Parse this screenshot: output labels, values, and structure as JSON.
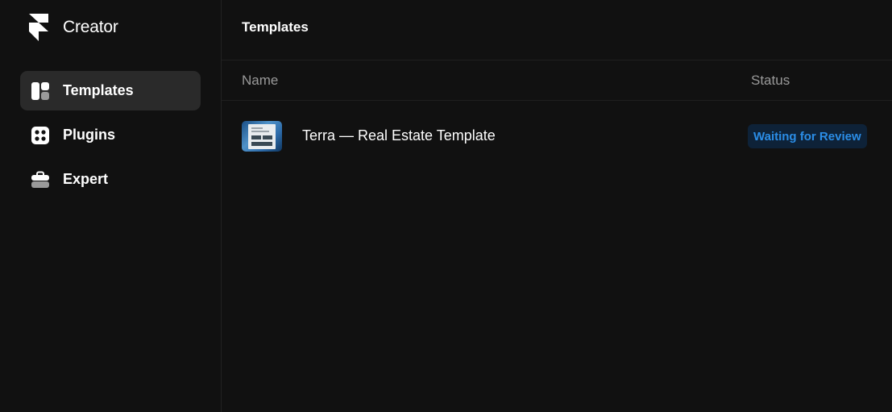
{
  "brand": {
    "name": "Creator",
    "icon": "framer-logo-icon"
  },
  "sidebar": {
    "items": [
      {
        "label": "Templates",
        "icon": "templates-icon",
        "active": true
      },
      {
        "label": "Plugins",
        "icon": "plugins-icon",
        "active": false
      },
      {
        "label": "Expert",
        "icon": "expert-briefcase-icon",
        "active": false
      }
    ]
  },
  "main": {
    "title": "Templates",
    "columns": {
      "name": "Name",
      "status": "Status"
    },
    "rows": [
      {
        "name": "Terra — Real Estate Template",
        "status": "Waiting for Review",
        "thumbnail": "template-thumbnail"
      }
    ]
  },
  "colors": {
    "background": "#111111",
    "active_nav": "#2a2a2a",
    "status_text": "#2b8de6",
    "status_bg": "#0e2238"
  }
}
